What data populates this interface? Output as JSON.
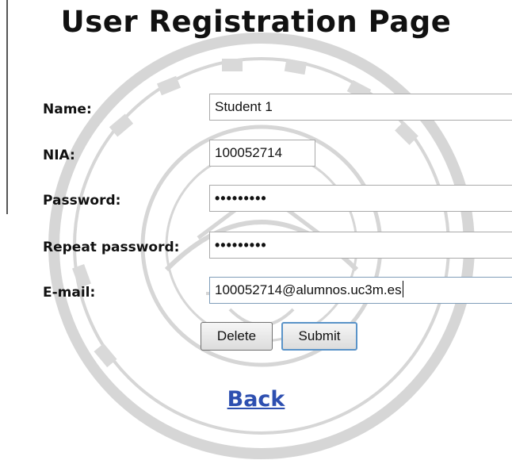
{
  "page": {
    "title": "User Registration Page",
    "back_link": "Back"
  },
  "form": {
    "name": {
      "label": "Name:",
      "value": "Student 1"
    },
    "nia": {
      "label": "NIA:",
      "value": "100052714"
    },
    "password": {
      "label": "Password:",
      "value": "•••••••••"
    },
    "repeat_password": {
      "label": "Repeat password:",
      "value": "•••••••••"
    },
    "email": {
      "label": "E-mail:",
      "value": "100052714@alumnos.uc3m.es"
    }
  },
  "buttons": {
    "delete_label": "Delete",
    "submit_label": "Submit"
  },
  "colors": {
    "link": "#2d4fb0",
    "focus_border": "#5a93c8",
    "watermark": "#d9d9d9"
  }
}
